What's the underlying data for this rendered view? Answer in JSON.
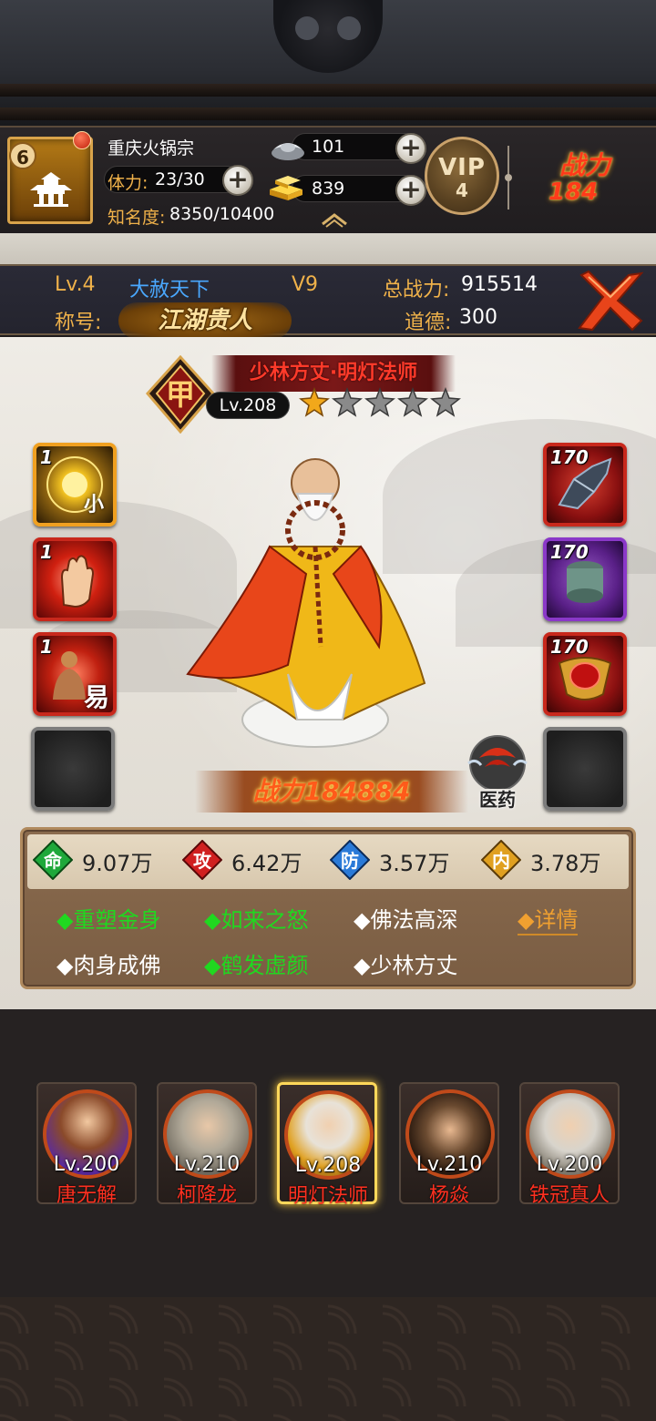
{
  "player": {
    "level": "6",
    "name": "重庆火锅宗",
    "stamina_label": "体力:",
    "stamina": "23/30",
    "fame_label": "知名度:",
    "fame": "8350/10400",
    "silver": "101",
    "gold": "839",
    "vip_label": "VIP",
    "vip_level": "4",
    "combat_label": "战力",
    "combat_partial": "184"
  },
  "info": {
    "level": "Lv.4",
    "server": "大赦天下",
    "vip": "V9",
    "total_power_label": "总战力:",
    "total_power": "915514",
    "title_label": "称号:",
    "title": "江湖贵人",
    "morality_label": "道德:",
    "morality": "300"
  },
  "hero": {
    "rank": "甲",
    "name": "少林方丈·明灯法师",
    "level": "Lv.208",
    "stars_filled": 1,
    "stars_total": 5,
    "power": "战力184884",
    "medicine_label": "医药"
  },
  "skills": [
    {
      "count": "1",
      "icon": "golden-orb-icon",
      "glyph": "小"
    },
    {
      "count": "1",
      "icon": "palm-icon",
      "glyph": ""
    },
    {
      "count": "1",
      "icon": "buddha-statue-icon",
      "glyph": "易"
    }
  ],
  "equipment": [
    {
      "level": "170",
      "icon": "gauntlet-icon"
    },
    {
      "level": "170",
      "icon": "jade-bracer-icon"
    },
    {
      "level": "170",
      "icon": "ruby-amulet-icon"
    }
  ],
  "stats": [
    {
      "key": "命",
      "value": "9.07万",
      "color": "#1fa83a"
    },
    {
      "key": "攻",
      "value": "6.42万",
      "color": "#d02020"
    },
    {
      "key": "防",
      "value": "3.57万",
      "color": "#2a7ad8"
    },
    {
      "key": "内",
      "value": "3.78万",
      "color": "#e0a020"
    }
  ],
  "traits": [
    {
      "label": "◆重塑金身",
      "active": true
    },
    {
      "label": "◆如来之怒",
      "active": true
    },
    {
      "label": "◆佛法高深",
      "active": false
    },
    {
      "label": "◆肉身成佛",
      "active": false
    },
    {
      "label": "◆鹤发虚颜",
      "active": true
    },
    {
      "label": "◆少林方丈",
      "active": false
    }
  ],
  "detail_label": "◆详情",
  "roster": [
    {
      "level": "Lv.200",
      "name": "唐无解",
      "selected": false
    },
    {
      "level": "Lv.210",
      "name": "柯降龙",
      "selected": false
    },
    {
      "level": "Lv.208",
      "name": "明灯法师",
      "selected": true
    },
    {
      "level": "Lv.210",
      "name": "杨焱",
      "selected": false
    },
    {
      "level": "Lv.200",
      "name": "铁冠真人",
      "selected": false
    }
  ],
  "colors": {
    "accent_gold": "#f0b24a",
    "trait_active": "#20d820",
    "hero_name_red": "#ff3a2a",
    "info_blue": "#4aa8ff"
  }
}
